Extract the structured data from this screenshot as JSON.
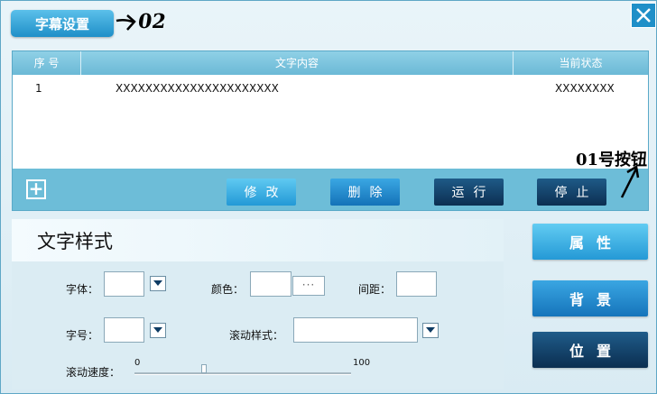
{
  "title_tab": "字幕设置",
  "annotations": {
    "tab_note": "02",
    "stop_note": "01号按钮"
  },
  "table": {
    "headers": [
      "序 号",
      "文字内容",
      "当前状态"
    ],
    "rows": [
      {
        "index": "1",
        "content": "XXXXXXXXXXXXXXXXXXXXXX",
        "status": "XXXXXXXX"
      }
    ]
  },
  "toolbar": {
    "add": "+",
    "edit": "修改",
    "delete": "删除",
    "run": "运行",
    "stop": "停止"
  },
  "text_style": {
    "heading": "文字样式",
    "font_label": "字体：",
    "color_label": "颜色：",
    "color_dots": "···",
    "spacing_label": "间距：",
    "size_label": "字号：",
    "scroll_style_label": "滚动样式：",
    "speed_label": "滚动速度：",
    "speed_min": "0",
    "speed_max": "100",
    "speed_value": 0.32
  },
  "side_buttons": {
    "properties": "属性",
    "background": "背景",
    "position": "位置"
  },
  "colors": {
    "accent": "#2399d6",
    "dark": "#0c2f52",
    "panel": "#6dbdd8"
  }
}
